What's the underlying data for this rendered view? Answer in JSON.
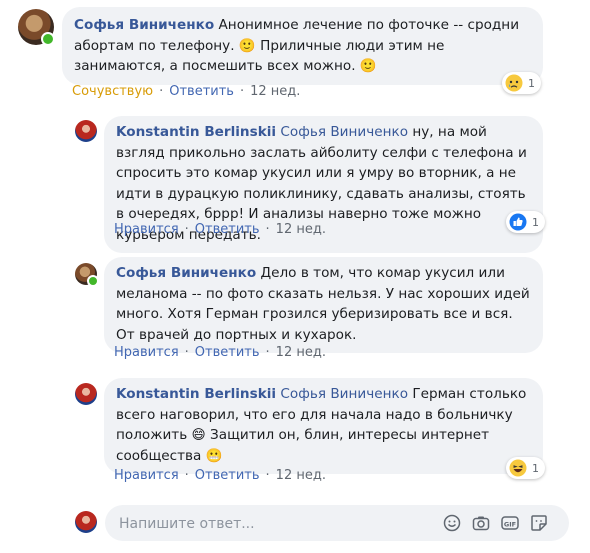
{
  "comments": [
    {
      "author": "Софья Виниченко",
      "text": " Анонимное лечение по фоточке -- сродни абортам по телефону. 🙂 Приличные люди этим не занимаются, а посмешить всех можно. 🙂",
      "actions": {
        "reaction": "Сочувствую",
        "reply": "Ответить",
        "time": "12 нед."
      },
      "reaction_count": "1",
      "reaction_icon": "sad-reaction-icon"
    },
    {
      "author": "Konstantin Berlinskii",
      "mention": "Софья Виниченко",
      "text": " ну, на мой взгляд прикольно заслать айболиту селфи с телефона и спросить это комар укусил или я умру во вторник, а не идти в дурацкую поликлинику, сдавать анализы, стоять в очередях, бррр! И анализы наверно тоже можно курьером передать.",
      "actions": {
        "like": "Нравится",
        "reply": "Ответить",
        "time": "12 нед."
      },
      "reaction_count": "1",
      "reaction_icon": "like-reaction-icon"
    },
    {
      "author": "Софья Виниченко",
      "text": " Дело в том, что комар укусил или меланома -- по фото сказать нельзя. У нас хороших идей много. Хотя Герман грозился уберизировать все и вся. От врачей до портных и кухарок.",
      "actions": {
        "like": "Нравится",
        "reply": "Ответить",
        "time": "12 нед."
      }
    },
    {
      "author": "Konstantin Berlinskii",
      "mention": "Софья Виниченко",
      "text": " Герман столько всего наговорил, что его для начала надо в больничку положить 😄 Защитил он, блин, интересы интернет сообщества 😬",
      "actions": {
        "like": "Нравится",
        "reply": "Ответить",
        "time": "12 нед."
      },
      "reaction_count": "1",
      "reaction_icon": "haha-reaction-icon"
    }
  ],
  "reply": {
    "placeholder": "Напишите ответ...",
    "icons": [
      "emoji-icon",
      "camera-icon",
      "gif-icon",
      "sticker-icon"
    ]
  },
  "colors": {
    "link": "#4267b2",
    "name": "#385898",
    "bubble": "#f0f2f5",
    "sad_reaction": "#d89c08"
  }
}
